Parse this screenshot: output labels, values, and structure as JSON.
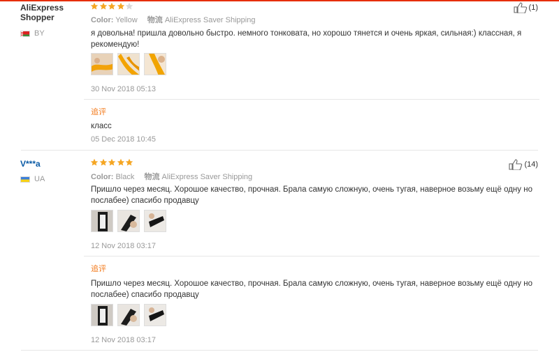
{
  "colors": {
    "accent": "#e62e04",
    "star": "#f5a623",
    "append": "#f37b1d"
  },
  "reviews": [
    {
      "user": "AliExpress\nShopper",
      "user_line1": "AliExpress",
      "user_line2": "Shopper",
      "country": "BY",
      "stars": 4,
      "color_label": "Color:",
      "color_value": "Yellow",
      "shipping_label": "物流",
      "shipping_value": "AliExpress Saver Shipping",
      "helpful_count": "(1)",
      "text": "я довольна! пришла довольно быстро. немного тонковата, но хорошо тянется и очень яркая, сильная:) классная, я рекомендую!",
      "date": "30 Nov 2018 05:13",
      "append_label": "追评",
      "append_text": "класс",
      "append_date": "05 Dec 2018 10:45"
    },
    {
      "user": "V***a",
      "country": "UA",
      "stars": 5,
      "color_label": "Color:",
      "color_value": "Black",
      "shipping_label": "物流",
      "shipping_value": "AliExpress Saver Shipping",
      "helpful_count": "(14)",
      "text": "Пришло через месяц. Хорошое качество, прочная. Брала самую сложную, очень тугая, наверное возьму ещё одну но послабее) спасибо продавцу",
      "date": "12 Nov 2018 03:17",
      "append_label": "追评",
      "append_text": "Пришло через месяц. Хорошое качество, прочная. Брала самую сложную, очень тугая, наверное возьму ещё одну но послабее) спасибо продавцу",
      "append_date": "12 Nov 2018 03:17"
    }
  ]
}
